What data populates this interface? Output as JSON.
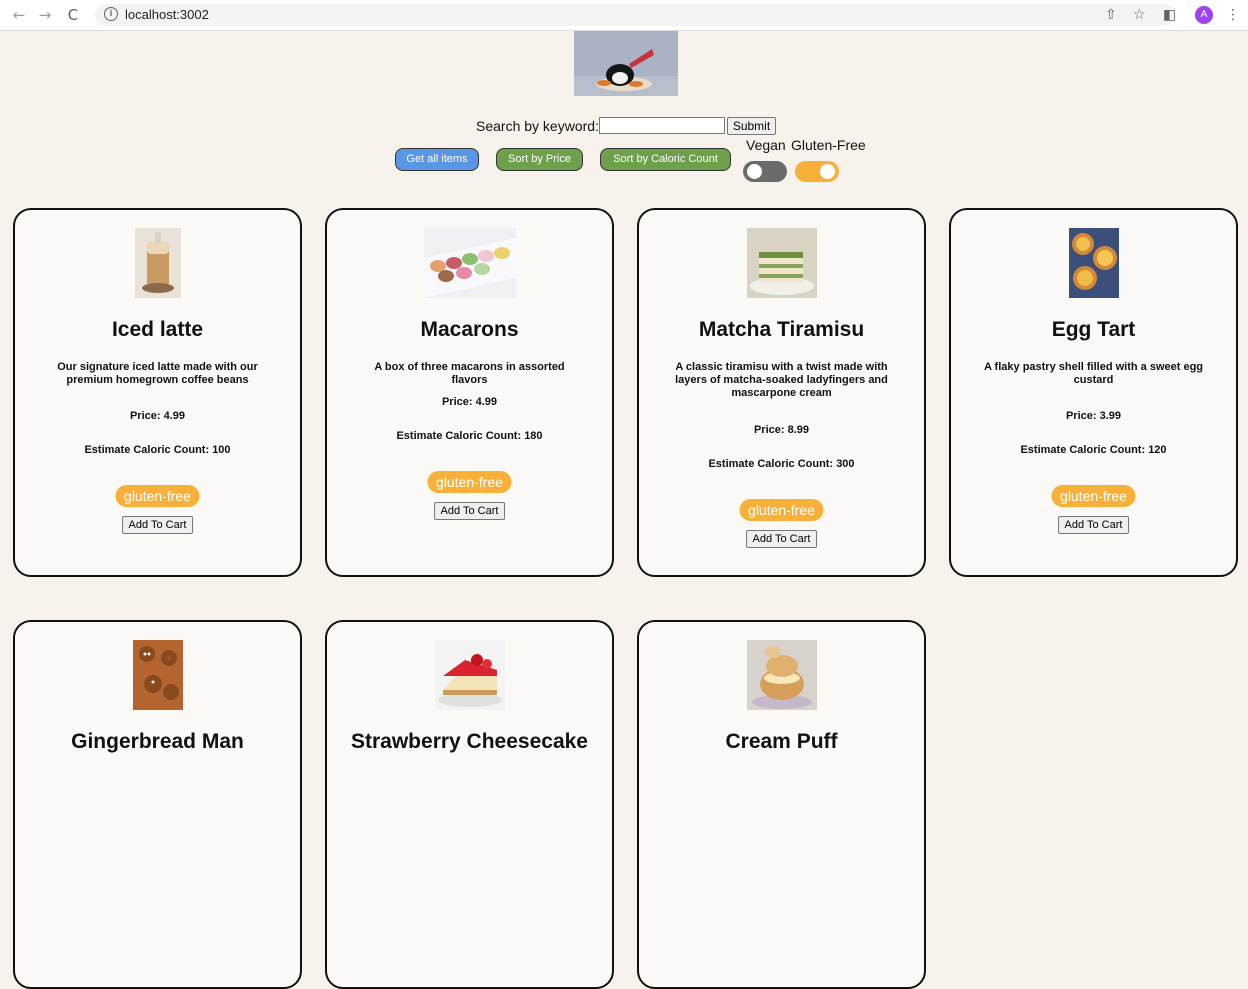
{
  "browser": {
    "url": "localhost:3002",
    "back_icon": "←",
    "forward_icon": "→",
    "reload_icon": "C",
    "info_icon": "i",
    "profile_initial": "A"
  },
  "search": {
    "label": "Search by keyword:",
    "value": "",
    "placeholder": "",
    "submit_label": "Submit"
  },
  "actions": {
    "get_all": "Get all items",
    "sort_price": "Sort by Price",
    "sort_calories": "Sort by Caloric Count"
  },
  "filters": {
    "vegan_label": "Vegan",
    "vegan_on": false,
    "gluten_label": "Gluten-Free",
    "gluten_on": true
  },
  "colors": {
    "accent_blue": "#5a96e6",
    "accent_green": "#6da04b",
    "toggle_on": "#f7b13b",
    "tag": "#f7b13b"
  },
  "items": [
    {
      "name": "Iced latte",
      "description": "Our signature iced latte made with our premium homegrown coffee beans",
      "price": "Price: 4.99",
      "calories": "Estimate Caloric Count: 100",
      "tag": "gluten-free",
      "button": "Add To Cart"
    },
    {
      "name": "Macarons",
      "description": "A box of three macarons in assorted flavors",
      "price": "Price: 4.99",
      "calories": "Estimate Caloric Count: 180",
      "tag": "gluten-free",
      "button": "Add To Cart"
    },
    {
      "name": "Matcha Tiramisu",
      "description": "A classic tiramisu with a twist made with layers of matcha-soaked ladyfingers and mascarpone cream",
      "price": "Price: 8.99",
      "calories": "Estimate Caloric Count: 300",
      "tag": "gluten-free",
      "button": "Add To Cart"
    },
    {
      "name": "Egg Tart",
      "description": "A flaky pastry shell filled with a sweet egg custard",
      "price": "Price: 3.99",
      "calories": "Estimate Caloric Count: 120",
      "tag": "gluten-free",
      "button": "Add To Cart"
    },
    {
      "name": "Gingerbread Man"
    },
    {
      "name": "Strawberry Cheesecake"
    },
    {
      "name": "Cream Puff"
    }
  ]
}
